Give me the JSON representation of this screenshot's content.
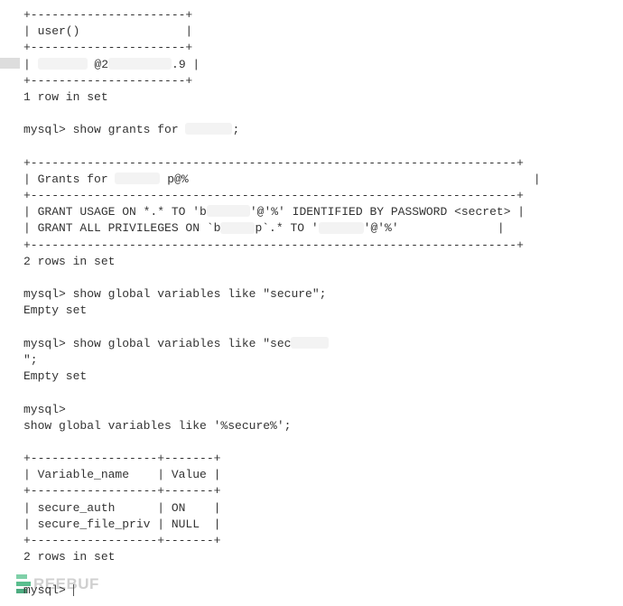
{
  "t1_border": "+----------------------+",
  "t1_header": "| user()               |",
  "t1_row_pre": "| ",
  "t1_row_mid": " @2",
  "t1_row_suf": ".9 |",
  "rows1": "1 row in set",
  "prompt": "mysql>",
  "cmd1": " show grants for ",
  "cmd1_suf": ";",
  "t2_border1": "+---------------------------------------------------------------------+",
  "t2_header_pre": "| Grants for ",
  "t2_header_mid": " p@%",
  "t2_header_suf": "                                                 |",
  "t2_border2": "+---------------------------------------------------------------------+",
  "t2_row1_pre": "| GRANT USAGE ON *.* TO 'b",
  "t2_row1_mid": "'@'%' IDENTIFIED BY PASSWORD <secret> |",
  "t2_row2_pre": "| GRANT ALL PRIVILEGES ON `b",
  "t2_row2_mid": "p`.* TO '",
  "t2_row2_suf": "'@'%'              |",
  "t2_border3": "+---------------------------------------------------------------------+",
  "rows2": "2 rows in set",
  "cmd2": " show global variables like \"secure\";",
  "empty": "Empty set",
  "cmd3": " show global variables like \"sec",
  "cmd3_cont": "\";",
  "cmd4": "show global variables like '%secure%';",
  "t3_border": "+------------------+-------+",
  "t3_header": "| Variable_name    | Value |",
  "t3_row1": "| secure_auth      | ON    |",
  "t3_row2": "| secure_file_priv | NULL  |",
  "rows3": "2 rows in set",
  "watermark": "REEBUF"
}
